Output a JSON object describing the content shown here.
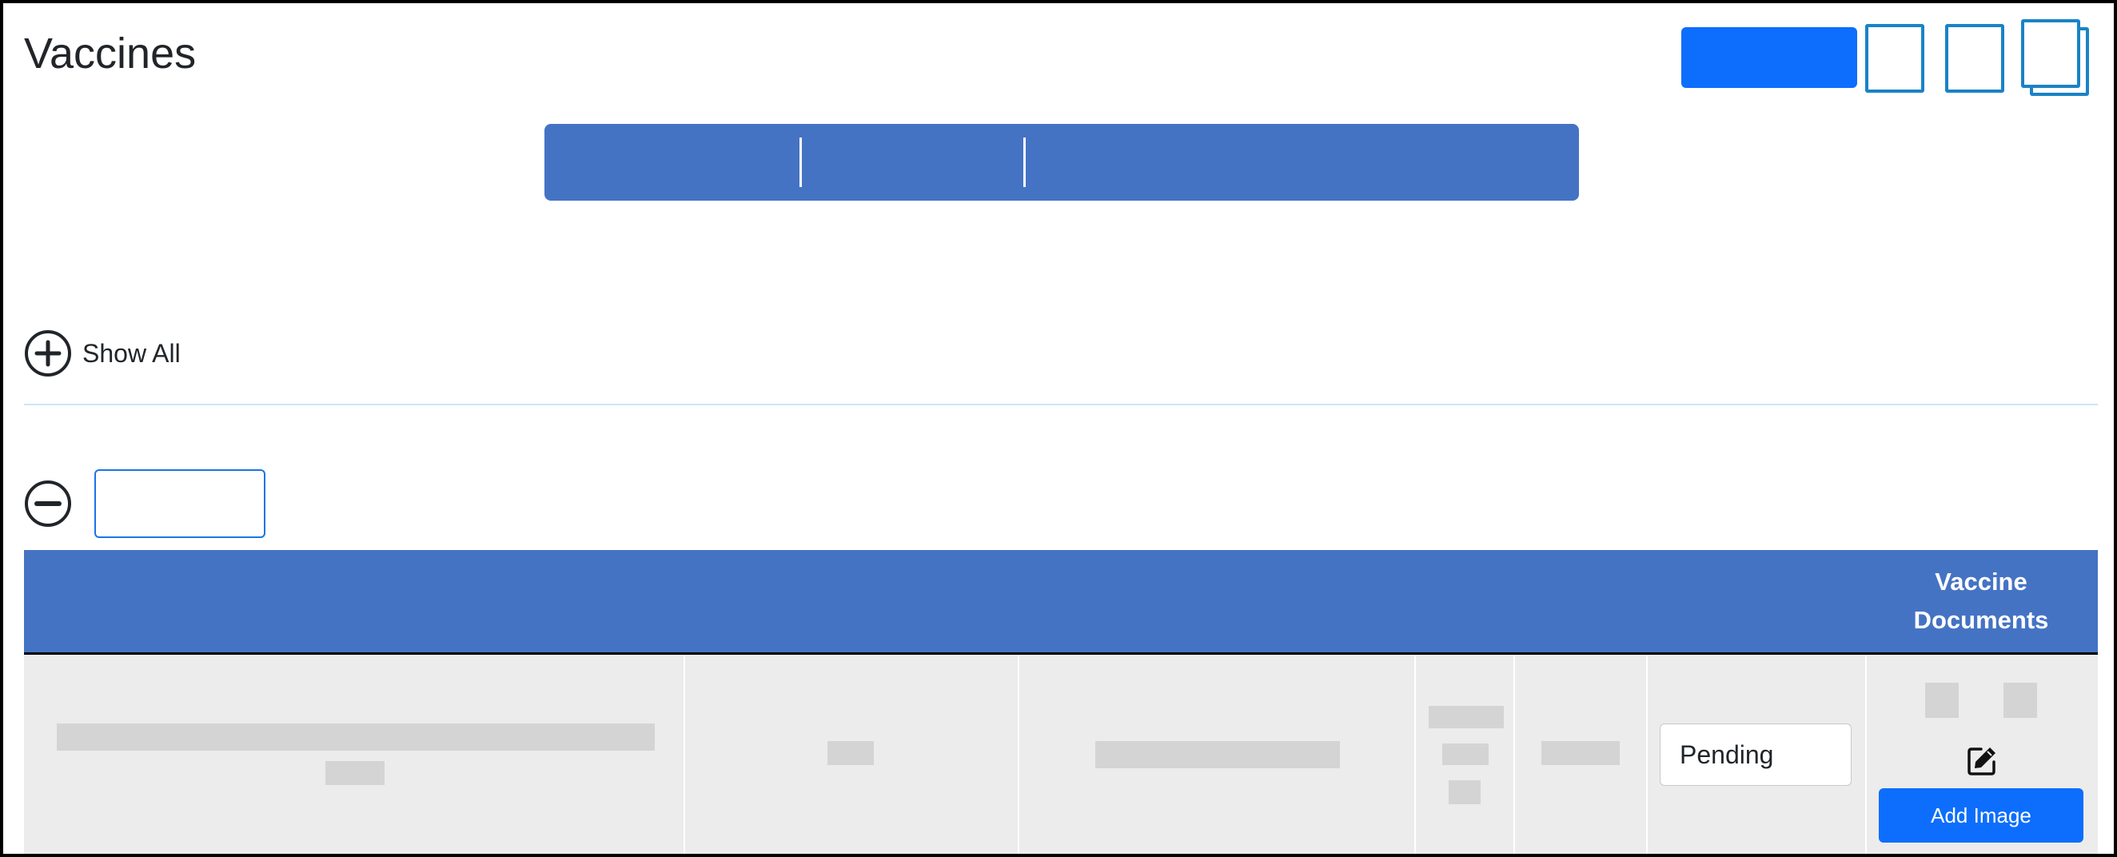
{
  "page": {
    "title": "Vaccines"
  },
  "toolbar": {
    "show_all_label": "Show All"
  },
  "group": {
    "input_value": ""
  },
  "table": {
    "headers": {
      "vaccine_documents": "Vaccine Documents"
    },
    "rows": [
      {
        "status": "Pending",
        "add_image_label": "Add Image"
      }
    ]
  },
  "icons": {
    "show_all": "plus-circle-icon",
    "collapse": "minus-circle-icon",
    "edit": "edit-icon"
  },
  "colors": {
    "primary": "#0d6efd",
    "header_blue": "#4573c4",
    "outline_blue": "#1a83c6",
    "row_bg": "#ececec",
    "placeholder": "#d4d4d4"
  }
}
